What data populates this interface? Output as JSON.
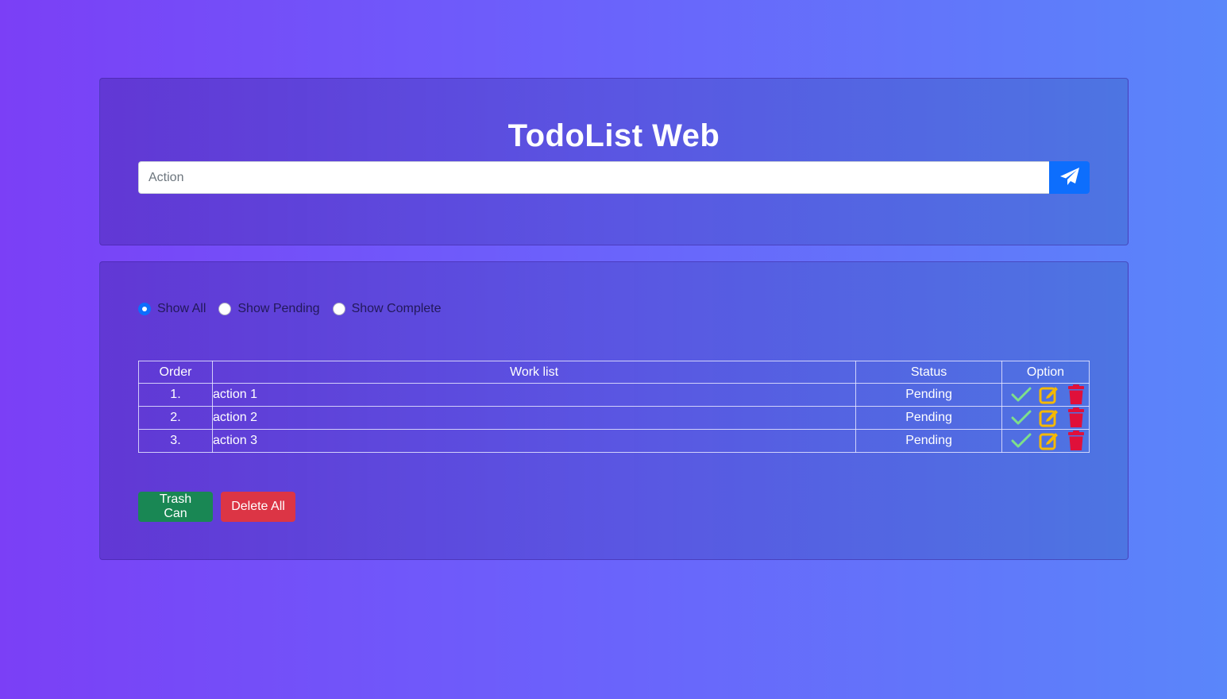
{
  "header": {
    "title": "TodoList Web",
    "input_placeholder": "Action",
    "input_value": "",
    "send_icon": "paper-plane-icon"
  },
  "filters": [
    {
      "label": "Show All",
      "checked": true
    },
    {
      "label": "Show Pending",
      "checked": false
    },
    {
      "label": "Show Complete",
      "checked": false
    }
  ],
  "table": {
    "columns": [
      "Order",
      "Work list",
      "Status",
      "Option"
    ],
    "rows": [
      {
        "order": "1.",
        "work": "action 1",
        "status": "Pending"
      },
      {
        "order": "2.",
        "work": "action 2",
        "status": "Pending"
      },
      {
        "order": "3.",
        "work": "action 3",
        "status": "Pending"
      }
    ],
    "option_icons": [
      "check-icon",
      "edit-icon",
      "trash-icon"
    ]
  },
  "actions": {
    "trash_can_label": "Trash Can",
    "delete_all_label": "Delete All"
  },
  "colors": {
    "primary": "#0d6efd",
    "success": "#198754",
    "danger": "#dc3545",
    "check": "#7ee08a",
    "edit": "#f5b800",
    "trash": "#e0103a"
  }
}
